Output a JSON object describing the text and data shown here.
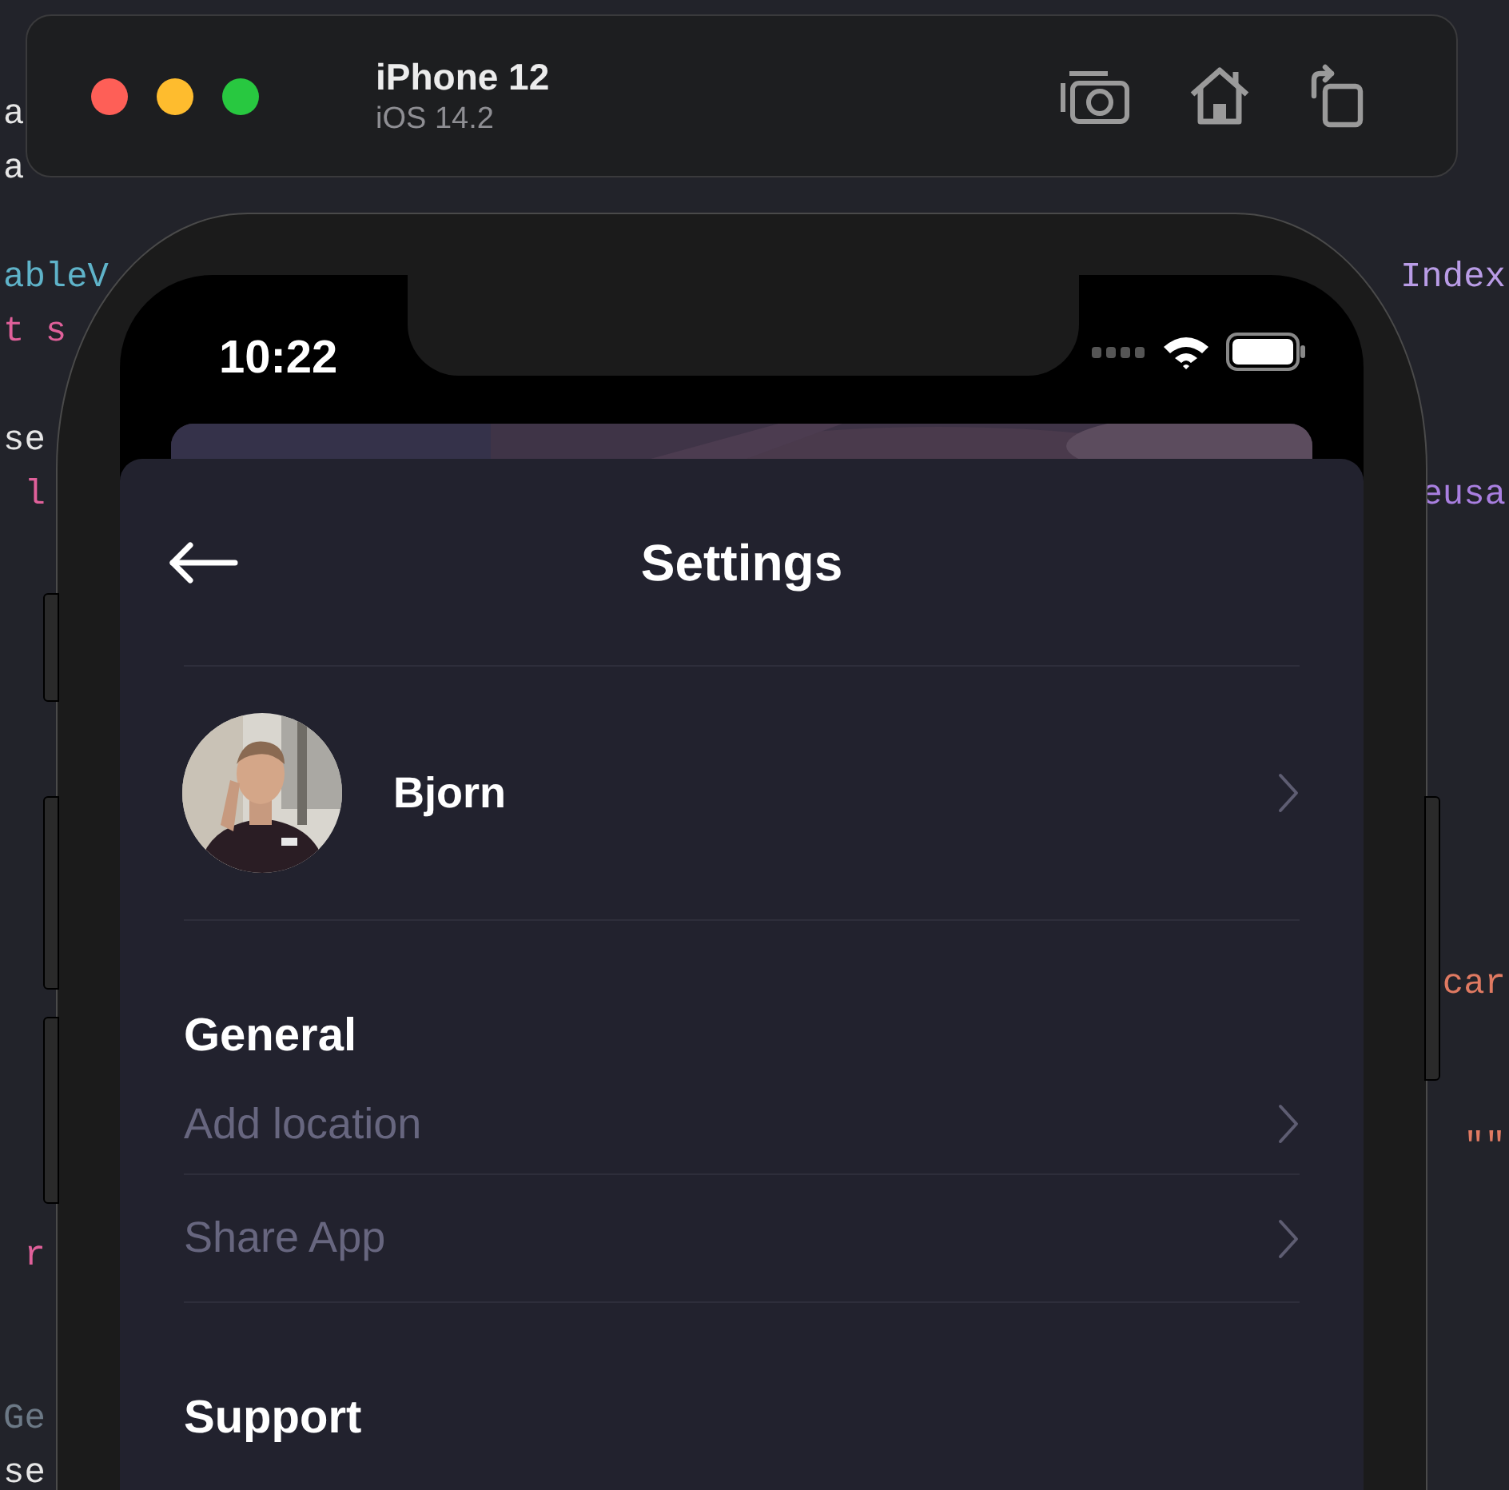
{
  "editor": {
    "left": [
      {
        "text": "a",
        "kind": "plain"
      },
      {
        "text": "a",
        "kind": "plain"
      },
      {
        "text": "ableV",
        "kind": "type"
      },
      {
        "text": "t s",
        "kind": "keyword"
      },
      {
        "text": "se",
        "kind": "plain"
      },
      {
        "text": " l",
        "kind": "keyword"
      },
      {
        "text": " r",
        "kind": "keyword"
      },
      {
        "text": "Ge",
        "kind": "comment"
      },
      {
        "text": "se",
        "kind": "plain"
      }
    ],
    "right": [
      {
        "text": "Index",
        "kind": "property"
      },
      {
        "text": "eusa",
        "kind": "method"
      },
      {
        "text": "car",
        "kind": "string"
      },
      {
        "text": "\"\"",
        "kind": "string"
      }
    ]
  },
  "simulator": {
    "title": "iPhone 12",
    "subtitle": "iOS 14.2"
  },
  "status_bar": {
    "time": "10:22"
  },
  "screen": {
    "title": "Settings",
    "profile": {
      "name": "Bjorn"
    },
    "sections": [
      {
        "title": "General",
        "items": [
          {
            "label": "Add location"
          },
          {
            "label": "Share App"
          }
        ]
      },
      {
        "title": "Support"
      }
    ]
  }
}
